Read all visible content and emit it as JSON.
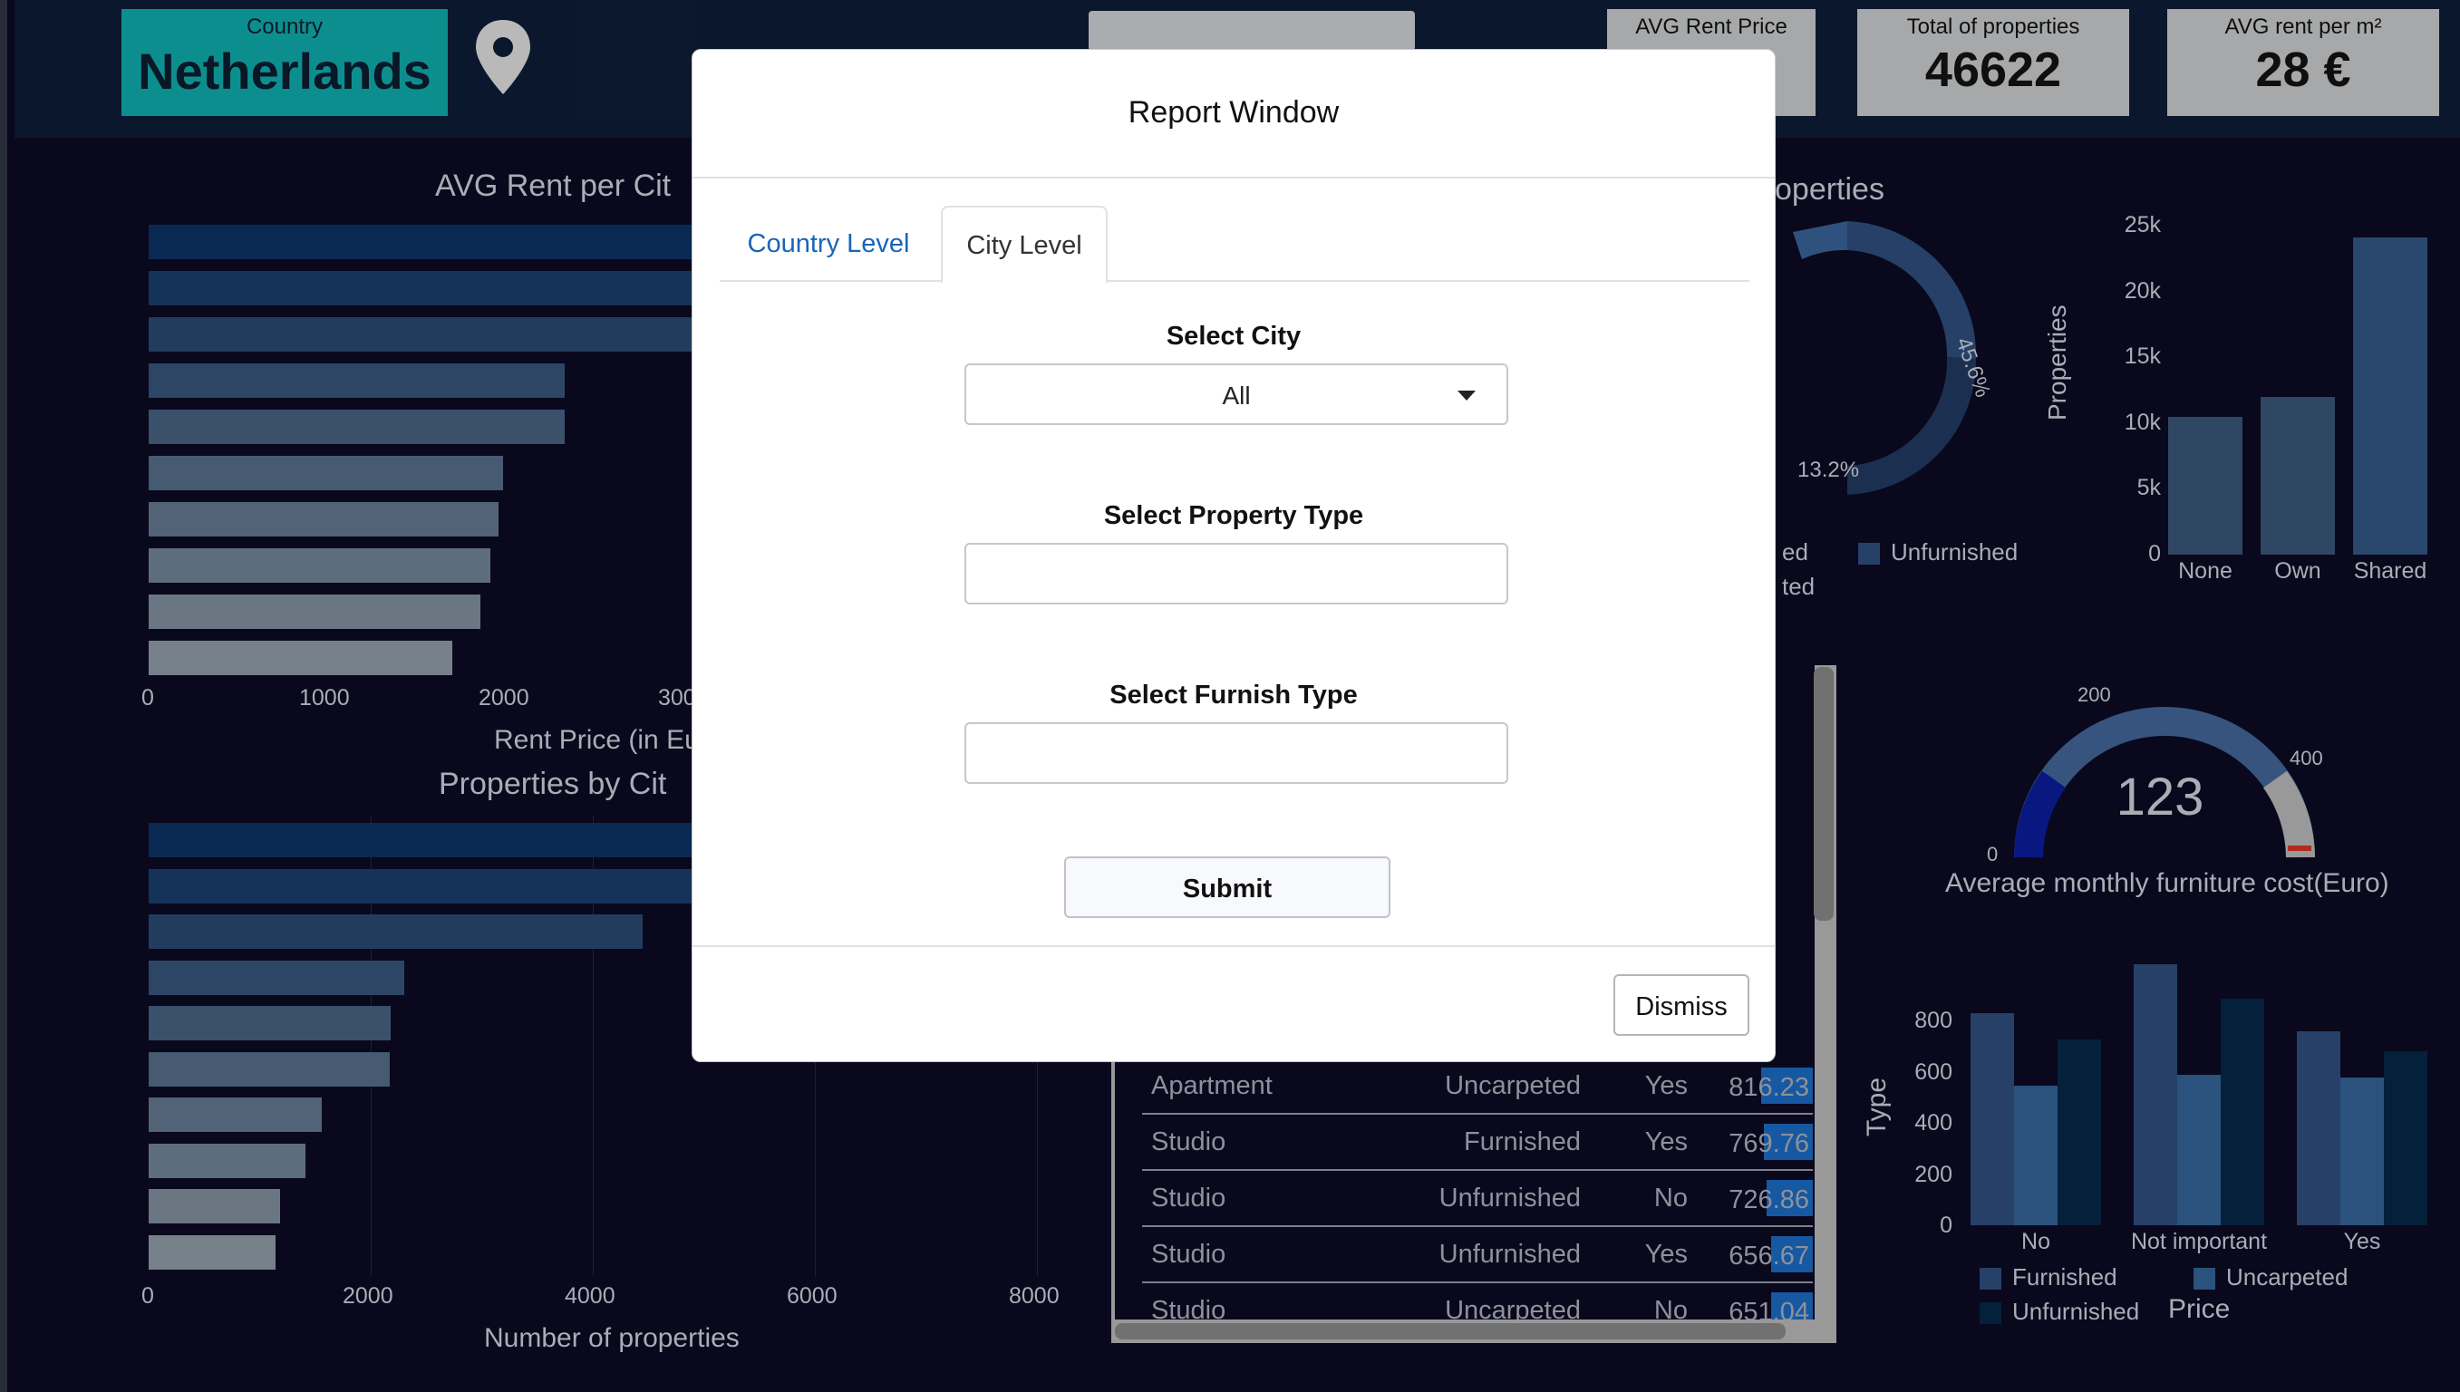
{
  "header": {
    "country_label": "Country",
    "country_value": "Netherlands",
    "kpis": [
      {
        "label": "AVG Rent Price",
        "value": ""
      },
      {
        "label": "Total of properties",
        "value": "46622"
      },
      {
        "label": "AVG rent per m²",
        "value": "28 €"
      }
    ]
  },
  "colors": {
    "background": "#0a0920",
    "country_box": "#0f9b9b",
    "bar_dark": "#0a3260",
    "bar_mid": "#1a6aa0",
    "bar_light": "#8a9aa6"
  },
  "charts": {
    "avg_rent": {
      "title": "AVG Rent per Cit",
      "xlabel": "Rent Price (in Eu",
      "ticks": [
        "0",
        "1000",
        "2000",
        "300"
      ]
    },
    "properties_by_city": {
      "title": "Properties by Cit",
      "xlabel": "Number of properties",
      "ticks": [
        "0",
        "2000",
        "4000",
        "6000",
        "8000"
      ]
    },
    "donut": {
      "title_fragment": "operties",
      "labels": [
        "45.6%",
        "13.2%"
      ],
      "legend": [
        "ed",
        "Unfurnished",
        "ted"
      ]
    },
    "shared_bar": {
      "ylabel": "Properties",
      "yticks": [
        "25k",
        "20k",
        "15k",
        "10k",
        "5k",
        "0"
      ],
      "categories": [
        "None",
        "Own",
        "Shared"
      ]
    },
    "gauge": {
      "value": "123",
      "ticks": [
        "0",
        "200",
        "400"
      ],
      "caption": "Average monthly furniture cost(Euro)"
    },
    "type_bar": {
      "ylabel": "Type",
      "yticks": [
        "800",
        "600",
        "400",
        "200",
        "0"
      ],
      "categories": [
        "No",
        "Not important",
        "Yes"
      ],
      "legend": [
        "Furnished",
        "Uncarpeted",
        "Unfurnished"
      ],
      "extra_label": "Price"
    }
  },
  "chart_data": [
    {
      "type": "bar",
      "title": "AVG Rent per Cit",
      "xlabel": "Rent Price (in Eu",
      "orientation": "horizontal",
      "values": [
        3900,
        3800,
        3700,
        2520,
        2520,
        2150,
        2120,
        2070,
        2010,
        1840
      ],
      "xlim": [
        0,
        3000
      ]
    },
    {
      "type": "bar",
      "title": "Properties by Cit",
      "xlabel": "Number of properties",
      "orientation": "horizontal",
      "values": [
        8000,
        7900,
        4450,
        2300,
        2180,
        2170,
        1560,
        1410,
        1180,
        1140
      ],
      "xlim": [
        0,
        8000
      ]
    },
    {
      "type": "bar",
      "ylabel": "Properties",
      "categories": [
        "None",
        "Own",
        "Shared"
      ],
      "values": [
        10500,
        12000,
        24200
      ],
      "ylim": [
        0,
        25000
      ]
    },
    {
      "type": "bar",
      "ylabel": "Type",
      "categories": [
        "No",
        "Not important",
        "Yes"
      ],
      "series": [
        {
          "name": "Furnished",
          "values": [
            730,
            900,
            670
          ]
        },
        {
          "name": "Uncarpeted",
          "values": [
            480,
            520,
            510
          ]
        },
        {
          "name": "Unfurnished",
          "values": [
            640,
            780,
            600
          ]
        }
      ],
      "ylim": [
        0,
        900
      ]
    }
  ],
  "table": {
    "rows": [
      {
        "type": "Apartment",
        "furnish": "Uncarpeted",
        "flag": "Yes",
        "price": "816.23",
        "frac": 0.63
      },
      {
        "type": "Studio",
        "furnish": "Furnished",
        "flag": "Yes",
        "price": "769.76",
        "frac": 0.59
      },
      {
        "type": "Studio",
        "furnish": "Unfurnished",
        "flag": "No",
        "price": "726.86",
        "frac": 0.56
      },
      {
        "type": "Studio",
        "furnish": "Unfurnished",
        "flag": "Yes",
        "price": "656.67",
        "frac": 0.5
      },
      {
        "type": "Studio",
        "furnish": "Uncarpeted",
        "flag": "No",
        "price": "651.04",
        "frac": 0.5
      }
    ]
  },
  "modal": {
    "title": "Report Window",
    "tabs": [
      "Country Level",
      "City Level"
    ],
    "active_tab": "City Level",
    "city_label": "Select City",
    "city_value": "All",
    "property_label": "Select Property Type",
    "property_value": "",
    "furnish_label": "Select Furnish Type",
    "furnish_value": "",
    "submit_label": "Submit",
    "dismiss_label": "Dismiss"
  }
}
